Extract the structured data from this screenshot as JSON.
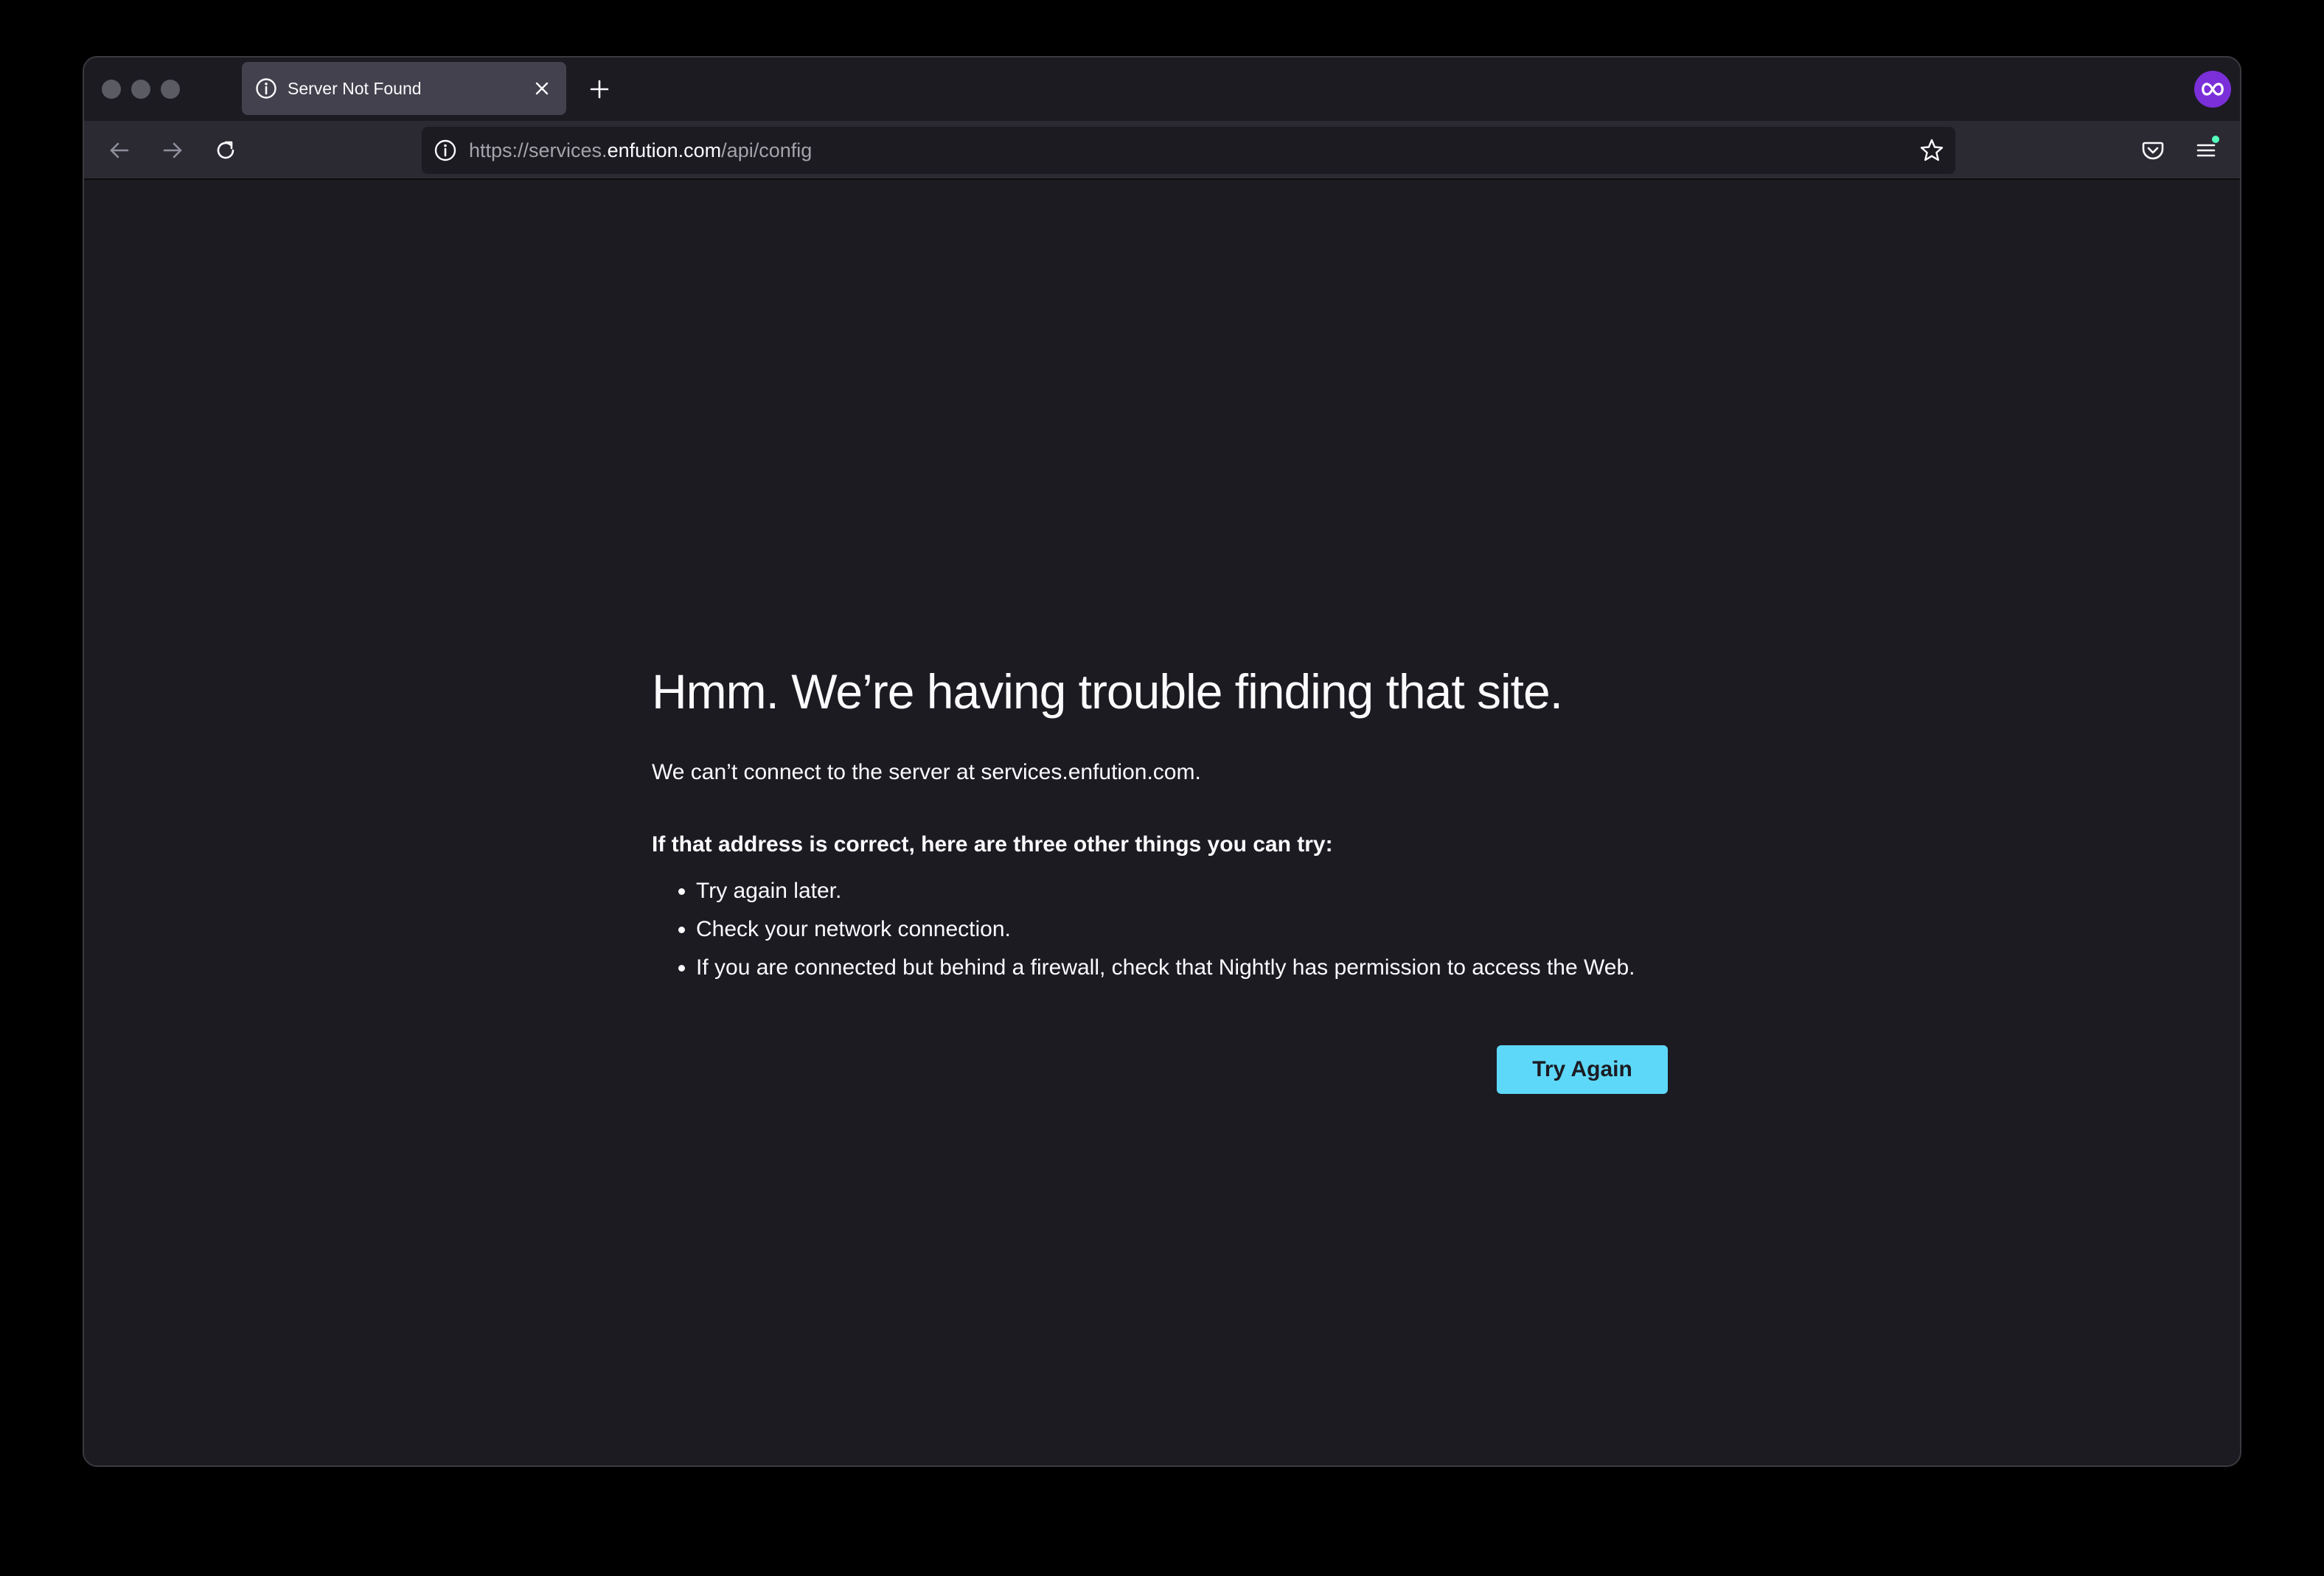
{
  "browser": {
    "tab": {
      "title": "Server Not Found",
      "icon": "info-icon"
    },
    "url": {
      "prefix": "https://services.",
      "host": "enfution.com",
      "path": "/api/config"
    },
    "toolbar_icons": [
      "back-arrow-icon",
      "forward-arrow-icon",
      "reload-icon",
      "star-icon",
      "pocket-icon",
      "hamburger-menu-icon",
      "account-icon"
    ],
    "accent_colors": {
      "tab_bg": "#42414d",
      "toolbar_bg": "#2b2a33",
      "content_bg": "#1c1b22",
      "button": "#5ed8f8",
      "account": "#7b2fd9"
    }
  },
  "error_page": {
    "title": "Hmm. We’re having trouble finding that site.",
    "description": "We can’t connect to the server at services.enfution.com.",
    "suggestions_heading": "If that address is correct, here are three other things you can try:",
    "suggestions": [
      "Try again later.",
      "Check your network connection.",
      "If you are connected but behind a firewall, check that Nightly has permission to access the Web."
    ],
    "try_again_label": "Try Again"
  }
}
